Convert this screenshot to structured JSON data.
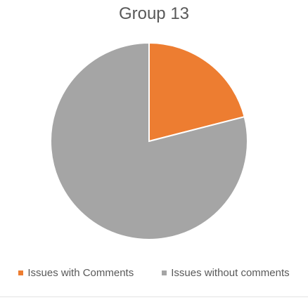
{
  "chart_data": {
    "type": "pie",
    "title": "Group 13",
    "categories": [
      "Issues with Comments",
      "Issues without comments"
    ],
    "values": [
      21,
      79
    ],
    "colors": [
      "#ED7D31",
      "#A5A5A5"
    ],
    "start_angle": "12 o'clock",
    "direction": "clockwise",
    "legend_position": "bottom"
  }
}
